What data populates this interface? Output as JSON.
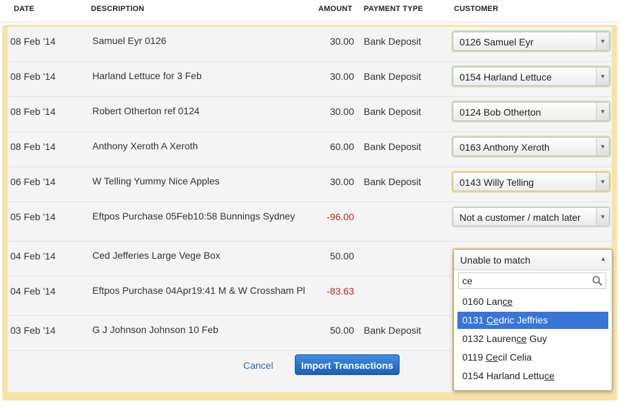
{
  "headers": {
    "date": "DATE",
    "description": "DESCRIPTION",
    "amount": "AMOUNT",
    "payment_type": "PAYMENT TYPE",
    "customer": "CUSTOMER"
  },
  "rows": [
    {
      "date": "08 Feb '14",
      "description": "Samuel Eyr 0126",
      "amount": "30.00",
      "payment_type": "Bank Deposit",
      "customer": "0126 Samuel Eyr"
    },
    {
      "date": "08 Feb '14",
      "description": "Harland Lettuce for 3 Feb",
      "amount": "30.00",
      "payment_type": "Bank Deposit",
      "customer": "0154 Harland Lettuce"
    },
    {
      "date": "08 Feb '14",
      "description": "Robert Otherton ref 0124",
      "amount": "30.00",
      "payment_type": "Bank Deposit",
      "customer": "0124 Bob Otherton"
    },
    {
      "date": "08 Feb '14",
      "description": "Anthony Xeroth A Xeroth",
      "amount": "60.00",
      "payment_type": "Bank Deposit",
      "customer": "0163 Anthony Xeroth"
    },
    {
      "date": "06 Feb '14",
      "description": "W Telling Yummy Nice Apples",
      "amount": "30.00",
      "payment_type": "Bank Deposit",
      "customer": "0143 Willy Telling"
    },
    {
      "date": "05 Feb '14",
      "description": "Eftpos Purchase 05Feb10:58 Bunnings Sydney",
      "amount": "-96.00",
      "payment_type": "",
      "customer": "Not a customer / match later"
    },
    {
      "date": "04 Feb '14",
      "description": "Ced Jefferies Large Vege Box",
      "amount": "50.00",
      "payment_type": "",
      "customer": "Unable to match"
    },
    {
      "date": "04 Feb '14",
      "description": "Eftpos Purchase 04Apr19:41 M & W Crossham Pl",
      "amount": "-83.63",
      "payment_type": "",
      "customer": ""
    },
    {
      "date": "03 Feb '14",
      "description": "G J Johnson Johnson 10 Feb",
      "amount": "50.00",
      "payment_type": "Bank Deposit",
      "customer": ""
    }
  ],
  "dropdown": {
    "selected": "Unable to match",
    "search_value": "ce",
    "options": [
      {
        "pre": "0160 Lan",
        "match": "ce",
        "post": ""
      },
      {
        "pre": "0131 ",
        "match": "Ce",
        "post": "dric Jeffries"
      },
      {
        "pre": "0132 Lauren",
        "match": "ce",
        "post": " Guy"
      },
      {
        "pre": "0119 ",
        "match": "Ce",
        "post": "cil Celia"
      },
      {
        "pre": "0154 Harland Lettu",
        "match": "ce",
        "post": ""
      }
    ],
    "highlighted_index": 1
  },
  "actions": {
    "cancel": "Cancel",
    "import": "Import Transactions"
  },
  "colors": {
    "panel": "#f7e3a8",
    "negative": "#c0261a",
    "link": "#2b6cb0",
    "highlight": "#3875d7"
  }
}
